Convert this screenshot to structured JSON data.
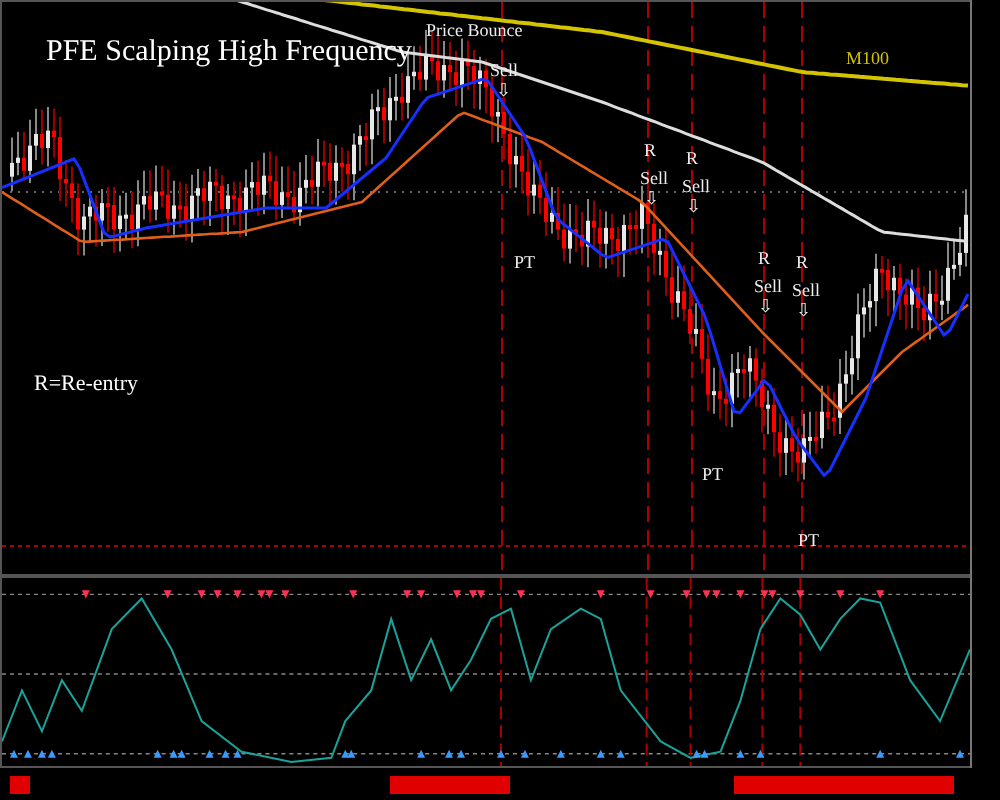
{
  "title": "PFE Scalping High Frequency",
  "note": "R=Re-entry",
  "ma_label": "M100",
  "annotations": [
    {
      "text": "Price Bounce"
    },
    {
      "text": "Sell"
    },
    {
      "text": "⇩"
    },
    {
      "text": "PT"
    },
    {
      "text": "R"
    },
    {
      "text": "Sell"
    },
    {
      "text": "⇩"
    },
    {
      "text": "R"
    },
    {
      "text": "Sell"
    },
    {
      "text": "⇩"
    },
    {
      "text": "R"
    },
    {
      "text": "Sell"
    },
    {
      "text": "⇩"
    },
    {
      "text": "R"
    },
    {
      "text": "Sell"
    },
    {
      "text": "⇩"
    },
    {
      "text": "PT"
    },
    {
      "text": "PT"
    }
  ]
}
